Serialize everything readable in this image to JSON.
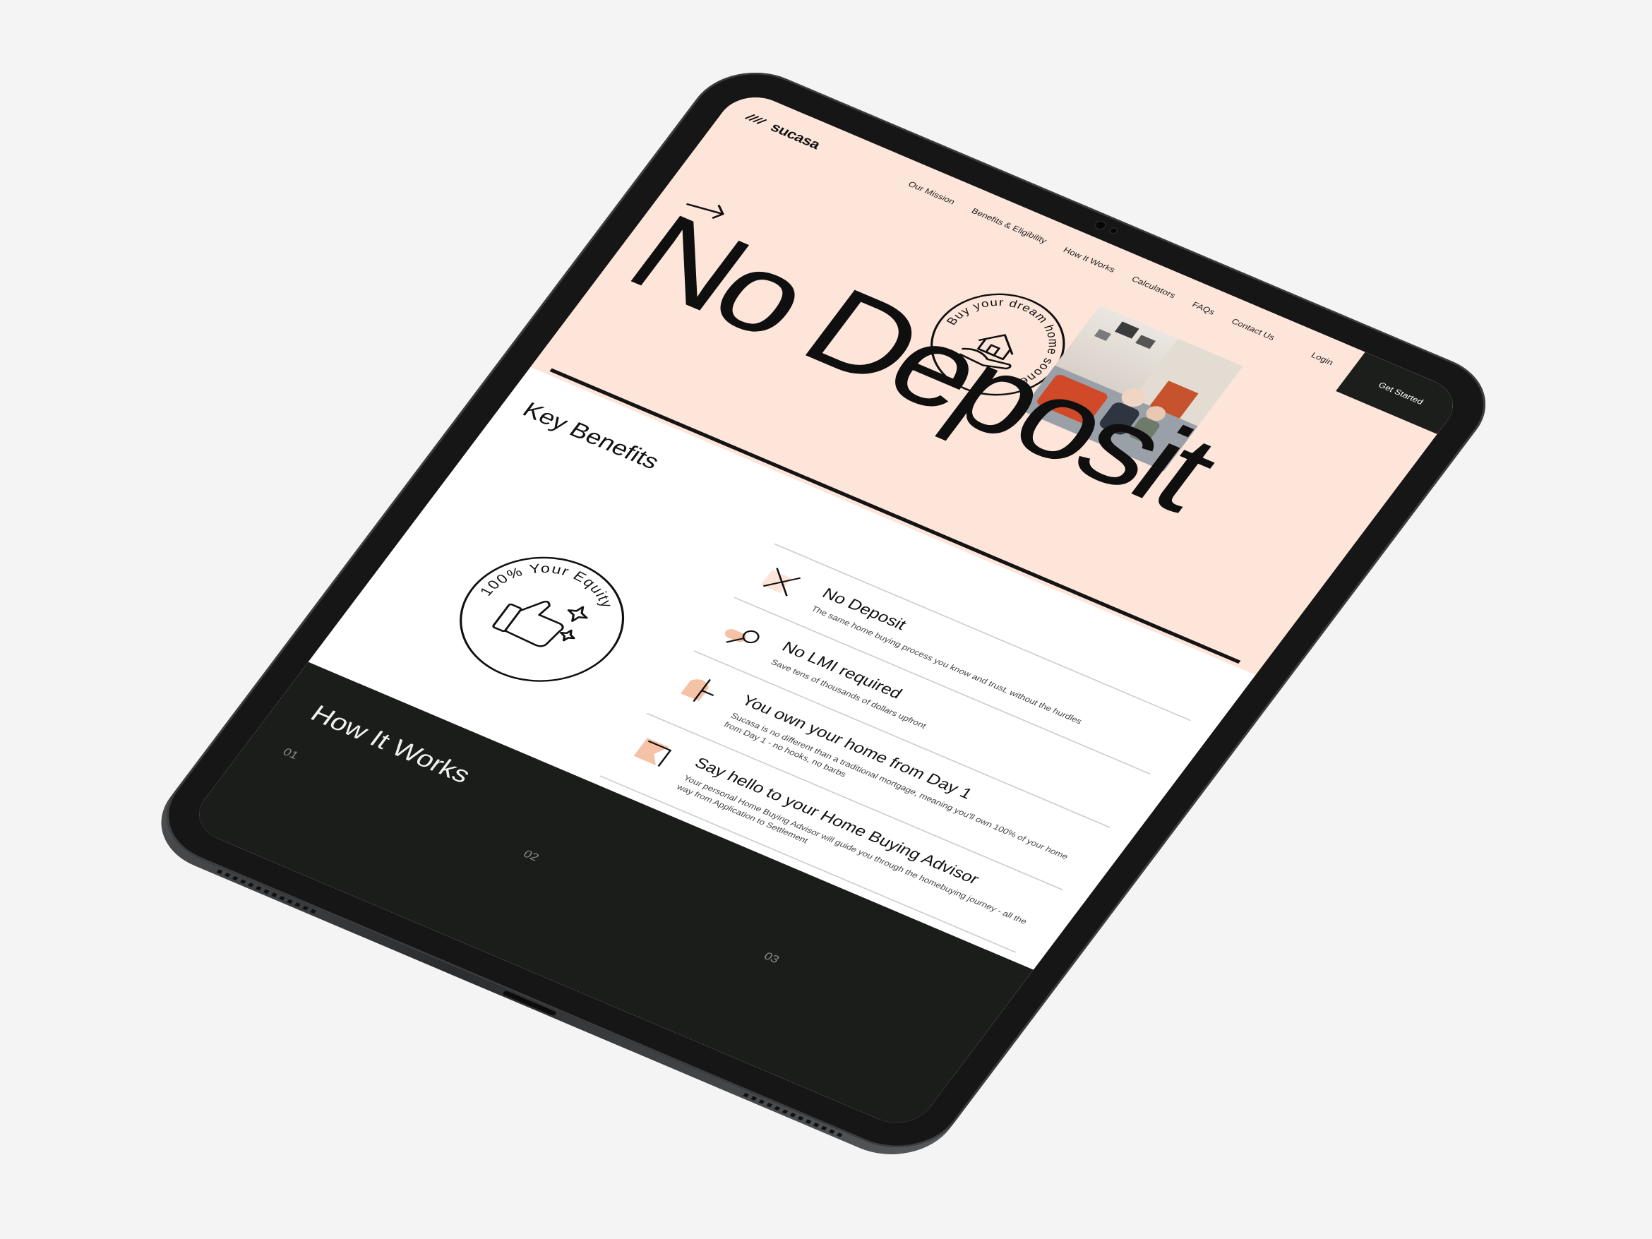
{
  "brand": {
    "name": "sucasa"
  },
  "nav": {
    "items": [
      {
        "label": "Our Mission"
      },
      {
        "label": "Benefits & Eligibility"
      },
      {
        "label": "How It Works"
      },
      {
        "label": "Calculators"
      },
      {
        "label": "FAQs"
      },
      {
        "label": "Contact Us"
      }
    ],
    "login_label": "Login",
    "cta_label": "Get Started"
  },
  "hero": {
    "title": "No Deposit",
    "badge_text": "Buy your dream home sooner"
  },
  "key_benefits": {
    "title": "Key Benefits",
    "badge_text": "100% Your Equity",
    "items": [
      {
        "title": "No Deposit",
        "description": "The same home buying process you know and trust, without the hurdles",
        "icon": "x-icon"
      },
      {
        "title": "No LMI required",
        "description": "Save tens of thousands of dollars upfront",
        "icon": "key-icon"
      },
      {
        "title": "You own your home from Day 1",
        "description": "Sucasa is no different than a traditional mortgage, meaning you'll own 100% of your home from Day 1 - no hooks, no barbs",
        "icon": "house-shape-icon"
      },
      {
        "title": "Say hello to your Home Buying Advisor",
        "description": "Your personal Home Buying Advisor will guide you through the homebuying journey - all the way from Application to Settlement",
        "icon": "flag-shape-icon"
      }
    ]
  },
  "how_it_works": {
    "title": "How It Works",
    "steps": [
      "01",
      "02",
      "03"
    ]
  },
  "colors": {
    "hero_bg": "#fde5da",
    "dark_bg": "#1a1d1a",
    "accent": "#f6c2a6",
    "text": "#111111"
  }
}
